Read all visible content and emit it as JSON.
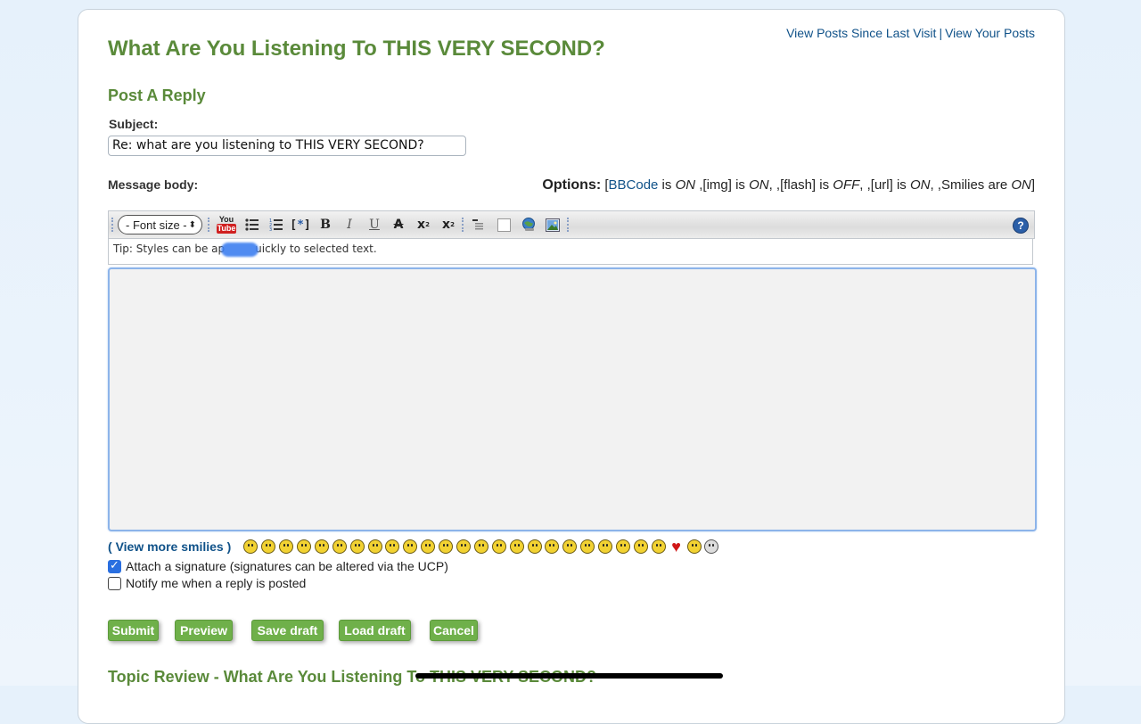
{
  "header": {
    "links": [
      "View Posts Since Last Visit",
      "View Your Posts"
    ],
    "separator": "|",
    "topic_title": "What Are You Listening To THIS VERY SECOND?",
    "section_title": "Post A Reply"
  },
  "form": {
    "subject_label": "Subject:",
    "subject_value": "Re: what are you listening to THIS VERY SECOND?",
    "message_label": "Message body:",
    "options": {
      "label": "Options:",
      "bbcode_link": "BBCode",
      "bbcode_text": " is ",
      "bbcode_state": "ON",
      "img_text": " ,[img] is ",
      "img_state": "ON",
      "flash_text": ", ,[flash] is ",
      "flash_state": "OFF",
      "url_text": ", ,[url] is ",
      "url_state": "ON",
      "smilies_text": ", ,Smilies are ",
      "smilies_state": "ON"
    },
    "toolbar": {
      "font_size_select": "- Font size -",
      "youtube_you": "You",
      "youtube_tube": "Tube",
      "help": "?"
    },
    "tip": {
      "before": "Tip: Styles can be ap",
      "after": "uickly to selected text."
    },
    "message_value": ""
  },
  "smilies": {
    "view_more_open": "( ",
    "view_more_link": "View more smilies",
    "view_more_close": " )",
    "icons": [
      "very-happy",
      "smile",
      "sad",
      "surprised",
      "shocked",
      "confused",
      "cool",
      "laughing",
      "mad",
      "razz",
      "embarrassed",
      "crying",
      "evil",
      "twisted-evil",
      "rolling-eyes",
      "wink",
      "exclamation",
      "question",
      "idea",
      "arrow",
      "neutral",
      "mr-green",
      "geek",
      "ugeek",
      "heart",
      "alien",
      "skull"
    ]
  },
  "checkboxes": [
    {
      "label": "Attach a signature (signatures can be altered via the UCP)",
      "checked": true
    },
    {
      "label": "Notify me when a reply is posted",
      "checked": false
    }
  ],
  "buttons": [
    "Submit",
    "Preview",
    "Save draft",
    "Load draft",
    "Cancel"
  ],
  "review": {
    "title": "Topic Review - What Are You Listening To THIS VERY SECOND?"
  },
  "colors": {
    "heading_green": "#5a8a3a",
    "link_blue": "#105289",
    "button_green": "#6fb04a",
    "focus_blue": "#8cb4ea"
  }
}
